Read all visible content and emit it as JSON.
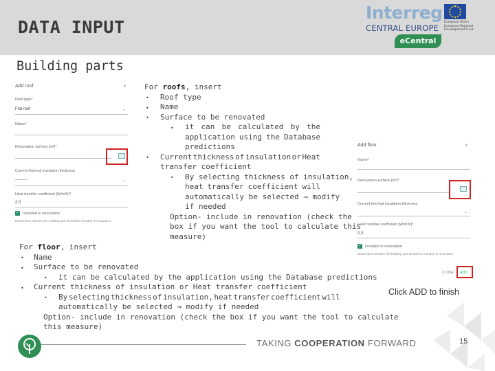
{
  "header": {
    "title": "DATA INPUT",
    "logo": {
      "wordmark": "Interreg",
      "subtitle": "CENTRAL EUROPE",
      "eu_text": "European Union European Regional Development Fund",
      "badge": "eCentral"
    }
  },
  "section_title": "Building parts",
  "roof_form": {
    "title": "Add roof",
    "close": "×",
    "roof_type_label": "Roof type*",
    "roof_type_value": "Flat roof",
    "name_label": "Name*",
    "renovation_surface_label": "Renovation surface [m²]*",
    "thermal_thickness_label": "Current thermal insulation thickness",
    "thermal_thickness_value": "---------",
    "heat_transfer_label": "Heat transfer coefficient [W/m²K]*",
    "heat_transfer_value": "2.0",
    "included_label": "Included in renovation",
    "included_help": "Determines whether the building part should be included in renovation"
  },
  "floor_form": {
    "title": "Add floor",
    "close": "×",
    "name_label": "Name*",
    "renovation_surface_label": "Renovation surface [m²]*",
    "thermal_thickness_label": "Current thermal insulation thickness",
    "heat_transfer_label": "Heat transfer coefficient [W/m²K]*",
    "heat_transfer_value": "0.3",
    "included_label": "Included in renovation",
    "included_help": "Determines whether the building part should be included in renovation",
    "close_button": "CLOSE",
    "add_button": "ADD"
  },
  "roof_text": {
    "intro_pre": "For ",
    "intro_bold": "roofs",
    "intro_post": ", insert",
    "b1": "Roof type",
    "b2": "Name",
    "b3": "Surface to be renovated",
    "b3_sub_l1": [
      "it",
      "can",
      "be",
      "calculated",
      "by",
      "the"
    ],
    "b3_sub_l2": [
      "application",
      "using",
      "the",
      "Database"
    ],
    "b3_sub_l3": "predictions",
    "b4_l1": [
      "Current",
      "thickness",
      "of",
      "insulation",
      "or",
      "Heat"
    ],
    "b4_l2": "transfer coefficient",
    "b4_sub_l1": "By selecting thickness of insulation,",
    "b4_sub_l2": [
      "heat",
      "transfer",
      "coefficient",
      "will"
    ],
    "b4_sub_l3": "automatically be selected → modify",
    "b4_sub_l4": "if needed",
    "option_l1": "Option- include in renovation (check the",
    "option_l2": "box if you want the tool to calculate this",
    "option_l3": "measure)"
  },
  "floor_text": {
    "intro_pre": "For ",
    "intro_bold": "floor",
    "intro_post": ", insert",
    "b1": "Name",
    "b2": "Surface to be renovated",
    "b2_sub": "it can be calculated by the application using the Database predictions",
    "b3": "Current thickness of insulation or Heat transfer coefficient",
    "b3_sub_l1": [
      "By",
      "selecting",
      "thickness",
      "of",
      "insulation,",
      "heat",
      "transfer",
      "coefficient",
      "will"
    ],
    "b3_sub_l2": "automatically be selected → modify if needed",
    "option_l1": "Option- include in renovation (check the box if you want the tool to calculate",
    "option_l2": "this measure)"
  },
  "click_add": "Click ADD to finish",
  "footer": {
    "tagline_pre": "TAKING ",
    "tagline_bold": "COOPERATION",
    "tagline_post": " FORWARD",
    "page_number": "15"
  },
  "colors": {
    "header_band": "#d9d9d9",
    "highlight_red": "#d02020",
    "brand_green": "#2f8f55",
    "interreg_blue": "#2c4a84"
  }
}
